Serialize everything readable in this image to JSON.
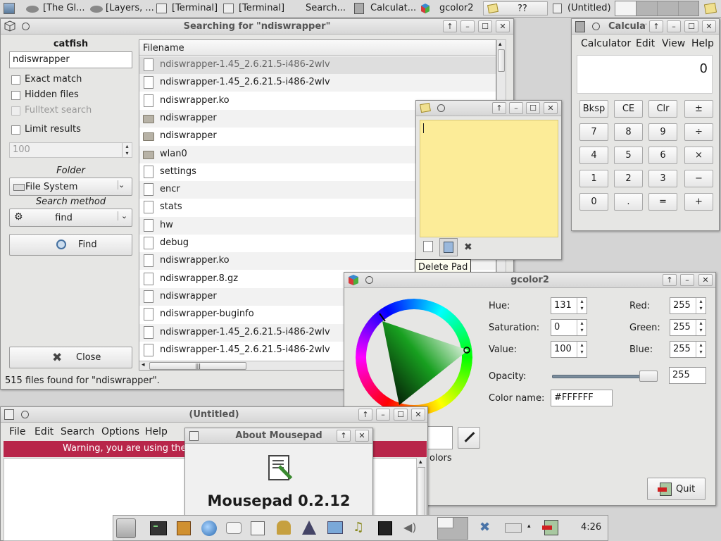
{
  "taskbar": {
    "items": [
      "[The Gl...",
      "[Layers, ...",
      "[Terminal]",
      "[Terminal]",
      "Search...",
      "Calculat...",
      "gcolor2",
      "??",
      "(Untitled)"
    ]
  },
  "catfish": {
    "title": "Searching for \"ndiswrapper\"",
    "app_name": "catfish",
    "query": "ndiswrapper",
    "exact_match": "Exact match",
    "hidden_files": "Hidden files",
    "fulltext": "Fulltext search",
    "limit_results": "Limit results",
    "limit_value": "100",
    "folder_label": "Folder",
    "folder_value": "File System",
    "method_label": "Search method",
    "method_value": "find",
    "find_button": "Find",
    "close_button": "Close",
    "column_header": "Filename",
    "files": [
      {
        "name": "ndiswrapper-1.45_2.6.21.5-i486-2wlv",
        "type": "file"
      },
      {
        "name": "ndiswrapper-1.45_2.6.21.5-i486-2wlv",
        "type": "file"
      },
      {
        "name": "ndiswrapper.ko",
        "type": "file"
      },
      {
        "name": "ndiswrapper",
        "type": "folder"
      },
      {
        "name": "ndiswrapper",
        "type": "folder"
      },
      {
        "name": "wlan0",
        "type": "folder"
      },
      {
        "name": "settings",
        "type": "file"
      },
      {
        "name": "encr",
        "type": "file"
      },
      {
        "name": "stats",
        "type": "file"
      },
      {
        "name": "hw",
        "type": "file"
      },
      {
        "name": "debug",
        "type": "file"
      },
      {
        "name": "ndiswrapper.ko",
        "type": "file"
      },
      {
        "name": "ndiswrapper.8.gz",
        "type": "file"
      },
      {
        "name": "ndiswrapper",
        "type": "file"
      },
      {
        "name": "ndiswrapper-buginfo",
        "type": "file"
      },
      {
        "name": "ndiswrapper-1.45_2.6.21.5-i486-2wlv",
        "type": "file"
      },
      {
        "name": "ndiswrapper-1.45_2.6.21.5-i486-2wlv",
        "type": "file"
      }
    ],
    "status": "515 files found for \"ndiswrapper\"."
  },
  "calculator": {
    "title": "Calculat",
    "menu": [
      "Calculator",
      "Edit",
      "View",
      "Help"
    ],
    "display": "0",
    "buttons": [
      "Bksp",
      "CE",
      "Clr",
      "±",
      "7",
      "8",
      "9",
      "÷",
      "4",
      "5",
      "6",
      "×",
      "1",
      "2",
      "3",
      "−",
      "0",
      ".",
      "=",
      "+"
    ]
  },
  "notes": {
    "tooltip": "Delete Pad"
  },
  "gcolor": {
    "title": "gcolor2",
    "hue_label": "Hue:",
    "hue": "131",
    "sat_label": "Saturation:",
    "sat": "0",
    "val_label": "Value:",
    "val": "100",
    "red_label": "Red:",
    "red": "255",
    "green_label": "Green:",
    "green": "255",
    "blue_label": "Blue:",
    "blue": "255",
    "opacity_label": "Opacity:",
    "opacity": "255",
    "colorname_label": "Color name:",
    "colorname": "#FFFFFF",
    "colors_text": "olors",
    "quit_button": "Quit"
  },
  "mousepad": {
    "title": "(Untitled)",
    "menu": [
      "File",
      "Edit",
      "Search",
      "Options",
      "Help"
    ],
    "warning": "Warning, you are using the"
  },
  "about": {
    "title": "About Mousepad",
    "heading": "Mousepad 0.2.12"
  },
  "panel": {
    "clock": "4:26"
  }
}
